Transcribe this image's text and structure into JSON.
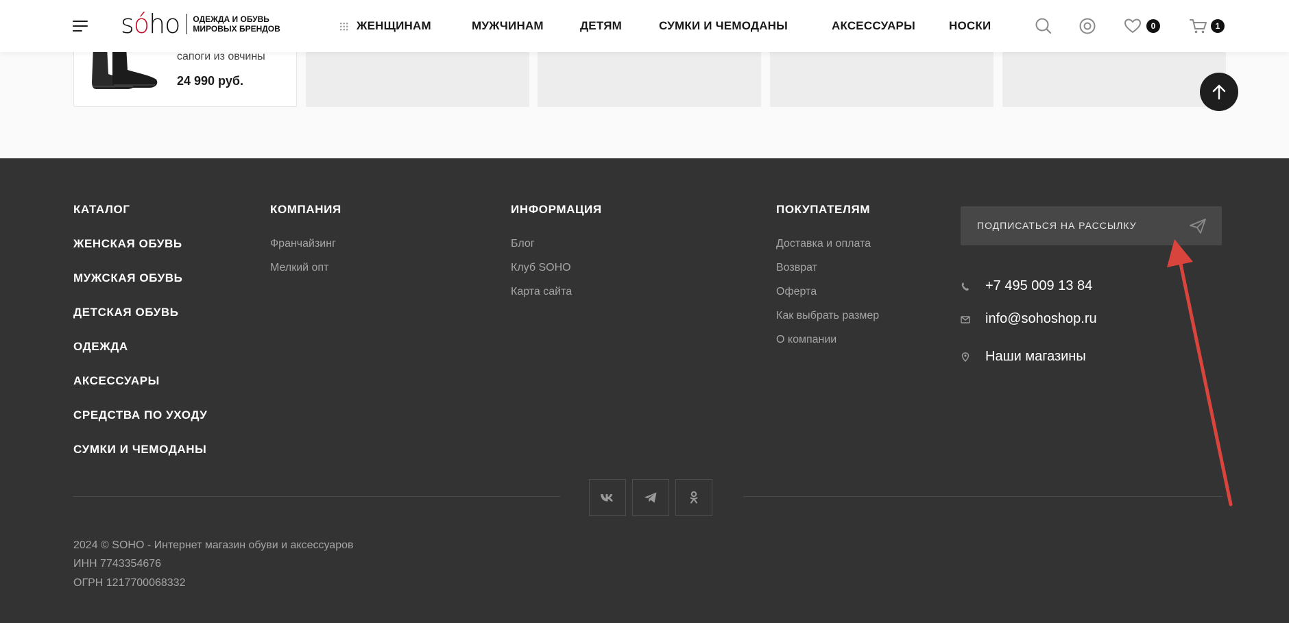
{
  "header": {
    "logo": {
      "word_prefix": "s",
      "word_accent": "ó",
      "word_suffix": "ho",
      "tagline_line1": "ОДЕЖДА И ОБУВЬ",
      "tagline_line2": "МИРОВЫХ БРЕНДОВ"
    },
    "nav": [
      "ЖЕНЩИНАМ",
      "МУЖЧИНАМ",
      "ДЕТЯМ",
      "СУМКИ И ЧЕМОДАНЫ",
      "АКСЕССУАРЫ",
      "НОСКИ"
    ],
    "wishlist_count": "0",
    "cart_count": "1"
  },
  "product": {
    "name": "сапоги из овчины",
    "price": "24 990 руб."
  },
  "footer": {
    "catalog": {
      "title": "КАТАЛОГ",
      "items": [
        "ЖЕНСКАЯ ОБУВЬ",
        "МУЖСКАЯ ОБУВЬ",
        "ДЕТСКАЯ ОБУВЬ",
        "ОДЕЖДА",
        "АКСЕССУАРЫ",
        "СРЕДСТВА ПО УХОДУ",
        "СУМКИ И ЧЕМОДАНЫ"
      ]
    },
    "company": {
      "title": "КОМПАНИЯ",
      "items": [
        "Франчайзинг",
        "Мелкий опт"
      ]
    },
    "info": {
      "title": "ИНФОРМАЦИЯ",
      "items": [
        "Блог",
        "Клуб SOHO",
        "Карта сайта"
      ]
    },
    "buyers": {
      "title": "ПОКУПАТЕЛЯМ",
      "items": [
        "Доставка и оплата",
        "Возврат",
        "Оферта",
        "Как выбрать размер",
        "О компании"
      ]
    },
    "subscribe_label": "ПОДПИСАТЬСЯ НА РАССЫЛКУ",
    "phone": "+7 495 009 13 84",
    "email": "info@sohoshop.ru",
    "stores": "Наши магазины",
    "legal": {
      "copyright": "2024 © SOHO - Интернет магазин обуви и аксессуаров",
      "inn": "ИНН 7743354676",
      "ogrn": "ОГРН 1217700068332"
    }
  },
  "icons": {
    "social": [
      "vk-icon",
      "telegram-icon",
      "odnoklassniki-icon"
    ],
    "header": [
      "search-icon",
      "account-icon",
      "heart-icon",
      "cart-icon"
    ]
  },
  "colors": {
    "footer_bg": "#333333",
    "annotation_arrow": "#d9453d",
    "logo_accent": "#c8102e"
  }
}
